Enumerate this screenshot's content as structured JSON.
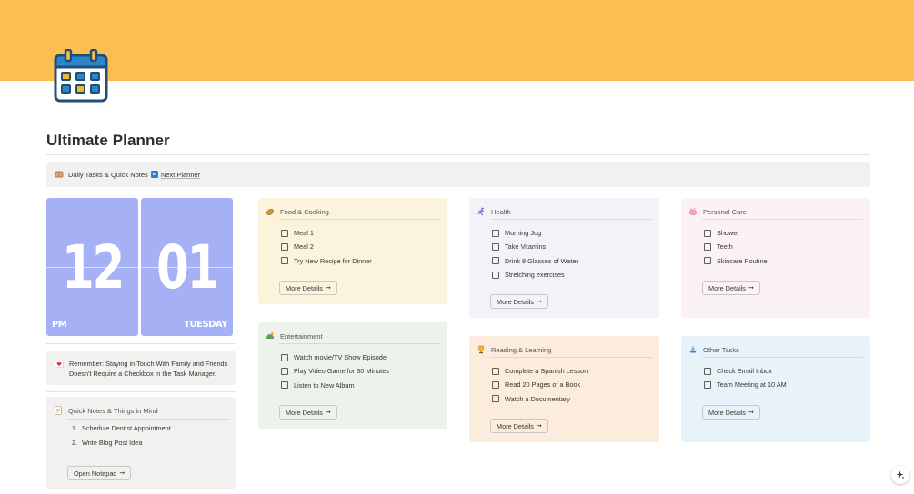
{
  "page": {
    "title": "Ultimate Planner"
  },
  "callout": {
    "text": "Daily Tasks & Quick Notes",
    "link": "Next Planner"
  },
  "clock": {
    "hour": "12",
    "minute": "01",
    "period": "PM",
    "weekday": "TUESDAY"
  },
  "reminder": {
    "text": "Remember: Staying in Touch With Family and Friends Doesn't Require a Checkbox in the Task Manager."
  },
  "notes": {
    "title": "Quick Notes & Things in Mind",
    "items": [
      {
        "n": "1.",
        "text": "Schedule Dentist Appointment"
      },
      {
        "n": "2.",
        "text": "Write Blog Post Idea"
      }
    ],
    "button": "Open Notepad"
  },
  "cards": {
    "food": {
      "title": "Food & Cooking",
      "items": [
        "Meal 1",
        "Meal 2",
        "Try New Recipe for Dinner"
      ],
      "button": "More Details",
      "bg": "#fbf3db"
    },
    "health": {
      "title": "Health",
      "items": [
        "Morning Jog",
        "Take Vitamins",
        "Drink 8 Glasses of Water",
        "Stretching exercises"
      ],
      "button": "More Details",
      "bg": "#f4f2f9"
    },
    "personal": {
      "title": "Personal Care",
      "items": [
        "Shower",
        "Teeth",
        "Skincare Routine"
      ],
      "button": "More Details",
      "bg": "#fbf2f5"
    },
    "entertainment": {
      "title": "Entertainment",
      "items": [
        "Watch movie/TV Show Episode",
        "Play Video Game for 30 Minutes",
        "Listen to New Album"
      ],
      "button": "More Details",
      "bg": "#edf3ec"
    },
    "reading": {
      "title": "Reading & Learning",
      "items": [
        "Complete a Spanish Lesson",
        "Read 20 Pages of a Book",
        "Watch a Documentary"
      ],
      "button": "More Details",
      "bg": "#fbecdd"
    },
    "other": {
      "title": "Other Tasks",
      "items": [
        "Check Email Inbox",
        "Team Meeting at 10 AM"
      ],
      "button": "More Details",
      "bg": "#e7f3f8"
    }
  },
  "colors": {
    "cover": "#fbbe52",
    "clock": "#a6b1f5"
  },
  "icons": {
    "page": "calendar-icon",
    "callout": "notebook-icon",
    "link": "arrow-right-box-icon",
    "reminder": "heart-letter-icon",
    "notes": "memo-icon",
    "food": "bread-icon",
    "health": "runner-icon",
    "personal": "soap-icon",
    "entertainment": "game-icon",
    "reading": "trophy-icon",
    "other": "ship-icon",
    "assistant": "sparkle-icon"
  }
}
